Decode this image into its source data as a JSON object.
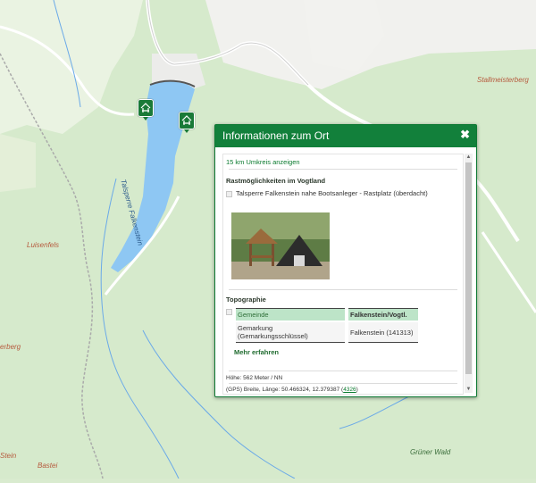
{
  "map": {
    "labels": [
      "Stallmeisterberg",
      "Talsperre Falkenstein",
      "Luisenfels",
      "Grüner Wald",
      "Bastei",
      "Stein",
      "erberg"
    ],
    "poi_icons": [
      "picnic-shelter-icon",
      "picnic-shelter-icon"
    ]
  },
  "popup": {
    "title": "Informationen zum Ort",
    "close_label": "✖",
    "radius_link": "15 km Umkreis anzeigen",
    "rest_heading": "Rastmöglichkeiten im Vogtland",
    "rest_item": "Talsperre Falkenstein nahe Bootsanleger - Rastplatz (überdacht)",
    "topo_heading": "Topographie",
    "topo_rows": [
      {
        "label": "Gemeinde",
        "value": "Falkenstein/Vogtl."
      },
      {
        "label": "Gemarkung (Gemarkungsschlüssel)",
        "value": "Falkenstein (141313)"
      }
    ],
    "more_link": "Mehr erfahren",
    "height_text": "Höhe: 562 Meter / NN",
    "gps_text": "(GPS) Breite, Länge: 50.466324, 12.379387 (",
    "gps_link": "4326",
    "gps_suffix": ")"
  },
  "colors": {
    "header": "#12803b",
    "link": "#0a7a2e",
    "water": "#8ec7f3"
  }
}
